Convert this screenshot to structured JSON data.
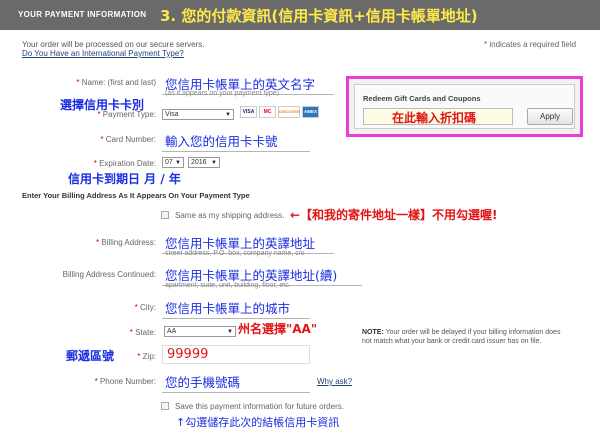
{
  "header": {
    "title": "YOUR PAYMENT INFORMATION",
    "annotation": "3. 您的付款資訊(信用卡資訊+信用卡帳單地址)"
  },
  "intro": {
    "secure_text": "Your order will be processed on our secure servers.",
    "intl_link": "Do You Have an International Payment Type?",
    "required_note": "* indicates a required field"
  },
  "name": {
    "label": "Name: (first and last)",
    "value": "您信用卡帳單上的英文名字",
    "hint": "(as it appears on your payment type)"
  },
  "payment_type": {
    "annotation": "選擇信用卡卡別",
    "label": "Payment Type:",
    "value": "Visa",
    "cards": [
      {
        "name": "VISA",
        "icon": "visa-icon",
        "color": "#1a1f71"
      },
      {
        "name": "MC",
        "icon": "mastercard-icon",
        "color": "#eb001b"
      },
      {
        "name": "DISCOVER",
        "icon": "discover-icon",
        "color": "#f58220"
      },
      {
        "name": "AMEX",
        "icon": "amex-icon",
        "color": "#2e77bb"
      }
    ]
  },
  "card_number": {
    "label": "Card Number:",
    "value": "輸入您的信用卡卡號"
  },
  "expiration": {
    "label": "Expiration Date:",
    "month": "07",
    "year": "2016",
    "annotation": "信用卡到期日   月 / 年"
  },
  "billing_heading": "Enter Your Billing Address As It Appears On Your Payment Type",
  "same_shipping": {
    "label": "Same as my shipping address.",
    "annotation": "←【和我的寄件地址一樣】不用勾選喔!"
  },
  "billing_address": {
    "label": "Billing Address:",
    "value": "您信用卡帳單上的英譯地址",
    "hint": "street address, P.O. box, company name, c/o"
  },
  "billing_address2": {
    "label": "Billing Address Continued:",
    "value": "您信用卡帳單上的英譯地址(續)",
    "hint": "apartment, suite, unit, building, floor, etc."
  },
  "city": {
    "label": "City:",
    "value": "您信用卡帳單上的城市"
  },
  "state": {
    "label": "State:",
    "value": "AA",
    "annotation": "州名選擇\"AA\""
  },
  "note": {
    "bold": "NOTE:",
    "text": " Your order will be delayed if your billing information does not match what your bank or credit card issuer has on file."
  },
  "zip": {
    "annotation": "郵遞區號",
    "label": "Zip:",
    "value": "99999"
  },
  "phone": {
    "label": "Phone Number:",
    "value": "您的手機號碼",
    "why_link": "Why ask?"
  },
  "save_info": {
    "label": "Save this payment information for future orders.",
    "annotation": "↑勾選儲存此次的結帳信用卡資訊"
  },
  "promo": {
    "title": "Redeem Gift Cards and Coupons",
    "input_annotation": "在此輸入折扣碼",
    "apply_label": "Apply"
  }
}
